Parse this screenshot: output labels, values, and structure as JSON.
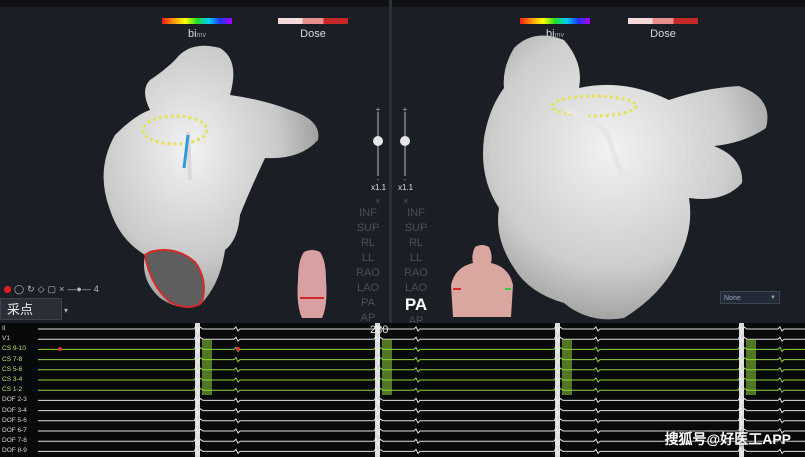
{
  "legend": {
    "bimv_label": "bi",
    "bimv_sub": "mv",
    "dose_label": "Dose"
  },
  "left_view": {
    "zoom_value": "x1.1",
    "close": "×",
    "views": [
      "INF",
      "SUP",
      "RL",
      "LL",
      "RAO",
      "LAO",
      "PA",
      "AP"
    ],
    "active": ""
  },
  "right_view": {
    "zoom_value": "x1.1",
    "close": "×",
    "views": [
      "INF",
      "SUP",
      "RL",
      "LL",
      "RAO",
      "LAO",
      "PA",
      "AP"
    ],
    "active": "PA"
  },
  "toolbar": {
    "collect_label": "采点",
    "count": "4"
  },
  "dropdown": {
    "selected": "None"
  },
  "ecg": {
    "timer": "280",
    "channels": [
      {
        "name": "II",
        "color": "#e0e0e0"
      },
      {
        "name": "V1",
        "color": "#e0e0e0"
      },
      {
        "name": "CS 9-10",
        "color": "#8fd13a"
      },
      {
        "name": "CS 7-8",
        "color": "#8fd13a"
      },
      {
        "name": "CS 5-6",
        "color": "#8fd13a"
      },
      {
        "name": "CS 3-4",
        "color": "#8fd13a"
      },
      {
        "name": "CS 1-2",
        "color": "#8fd13a"
      },
      {
        "name": "DOF 2-3",
        "color": "#e0e0e0"
      },
      {
        "name": "DOF 3-4",
        "color": "#e0e0e0"
      },
      {
        "name": "DOF 5-6",
        "color": "#e0e0e0"
      },
      {
        "name": "DOF 6-7",
        "color": "#e0e0e0"
      },
      {
        "name": "DOF 7-8",
        "color": "#e0e0e0"
      },
      {
        "name": "DOF 8-9",
        "color": "#e0e0e0"
      }
    ]
  },
  "watermark": "搜狐号@好医工APP",
  "colors": {
    "background": "#15181d",
    "ecg_bg": "#08090b",
    "green": "#8fd13a",
    "scar": "#d42a2a"
  }
}
